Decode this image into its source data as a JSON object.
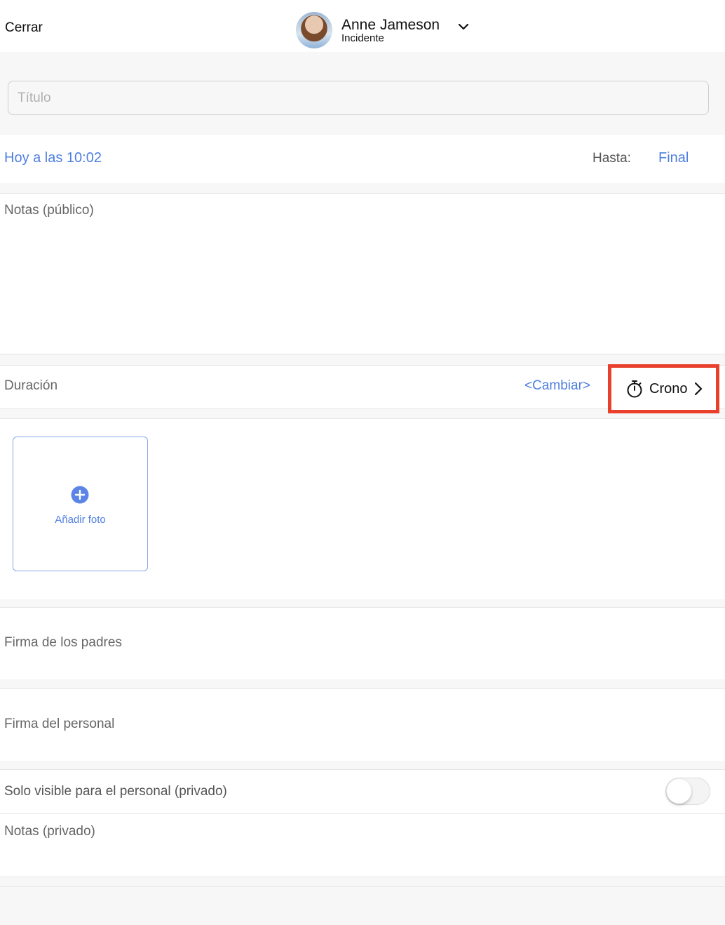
{
  "header": {
    "close_label": "Cerrar",
    "profile_name": "Anne Jameson",
    "profile_subtitle": "Incidente"
  },
  "title_field": {
    "placeholder": "Título",
    "value": ""
  },
  "date_row": {
    "start_label": "Hoy a las 10:02",
    "until_label": "Hasta:",
    "until_value": "Final"
  },
  "public_notes": {
    "label": "Notas (público)"
  },
  "duration": {
    "label": "Duración",
    "change_label": "<Cambiar>",
    "timer_label": "Crono"
  },
  "photos": {
    "add_label": "Añadir foto"
  },
  "signatures": {
    "parents_label": "Firma de los padres",
    "staff_label": "Firma del personal"
  },
  "private": {
    "visibility_label": "Solo visible para el personal (privado)",
    "visibility_on": false,
    "notes_label": "Notas (privado)"
  },
  "colors": {
    "accent": "#4f7fe0",
    "highlight": "#e8402b",
    "background": "#f7f7f7"
  },
  "icons": {
    "dropdown": "chevron-down-icon",
    "timer": "stopwatch-icon",
    "next": "chevron-right-icon",
    "add": "plus-circle-icon"
  }
}
